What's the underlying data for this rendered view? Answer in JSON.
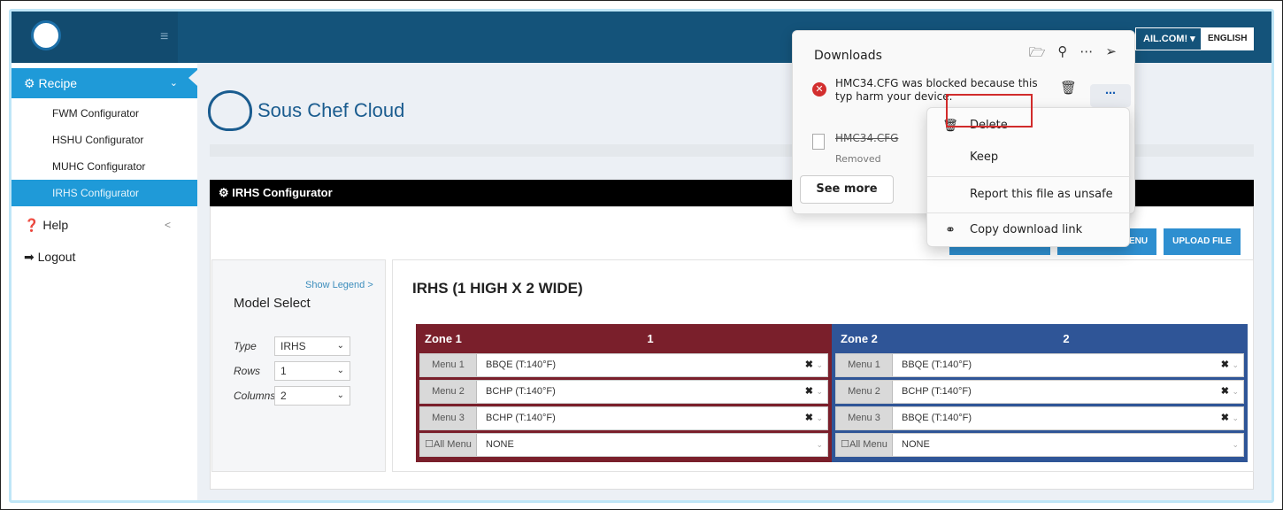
{
  "header": {
    "email_label": "AIL.COM! ▾",
    "language_label": "ENGLISH"
  },
  "sidebar": {
    "recipe_label": "Recipe",
    "items": [
      {
        "label": "FWM Configurator"
      },
      {
        "label": "HSHU Configurator"
      },
      {
        "label": "MUHC Configurator"
      },
      {
        "label": "IRHS Configurator"
      }
    ],
    "help_label": "Help",
    "logout_label": "Logout"
  },
  "brand": {
    "name": "Sous Chef Cloud"
  },
  "panel": {
    "title": "IRHS Configurator",
    "buttons": [
      "DOWNLOAD CONFI",
      "DOWNLOAD MENU",
      "UPLOAD FILE"
    ]
  },
  "model_select": {
    "legend_link": "Show Legend >",
    "title": "Model Select",
    "rows": [
      {
        "label": "Type",
        "value": "IRHS"
      },
      {
        "label": "Rows",
        "value": "1"
      },
      {
        "label": "Columns",
        "value": "2"
      }
    ]
  },
  "zones_title": "IRHS (1 HIGH X 2 WIDE)",
  "zones": [
    {
      "name": "Zone 1",
      "number": "1",
      "color": "#7a1f2b",
      "menus": [
        {
          "label": "Menu 1",
          "value": "BBQE (T:140°F)"
        },
        {
          "label": "Menu 2",
          "value": "BCHP (T:140°F)"
        },
        {
          "label": "Menu 3",
          "value": "BCHP (T:140°F)"
        }
      ],
      "all_menu": {
        "label": "☐All Menu",
        "value": "NONE"
      }
    },
    {
      "name": "Zone 2",
      "number": "2",
      "color": "#2f5597",
      "menus": [
        {
          "label": "Menu 1",
          "value": "BBQE (T:140°F)"
        },
        {
          "label": "Menu 2",
          "value": "BCHP (T:140°F)"
        },
        {
          "label": "Menu 3",
          "value": "BBQE (T:140°F)"
        }
      ],
      "all_menu": {
        "label": "☐All Menu",
        "value": "NONE"
      }
    }
  ],
  "downloads": {
    "title": "Downloads",
    "item1_message": "HMC34.CFG was blocked because this typ harm your device.",
    "item2_name": "HMC34.CFG",
    "item2_status": "Removed",
    "see_more": "See more"
  },
  "context_menu": {
    "items": [
      "Delete",
      "Keep",
      "Report this file as unsafe",
      "Copy download link"
    ]
  }
}
